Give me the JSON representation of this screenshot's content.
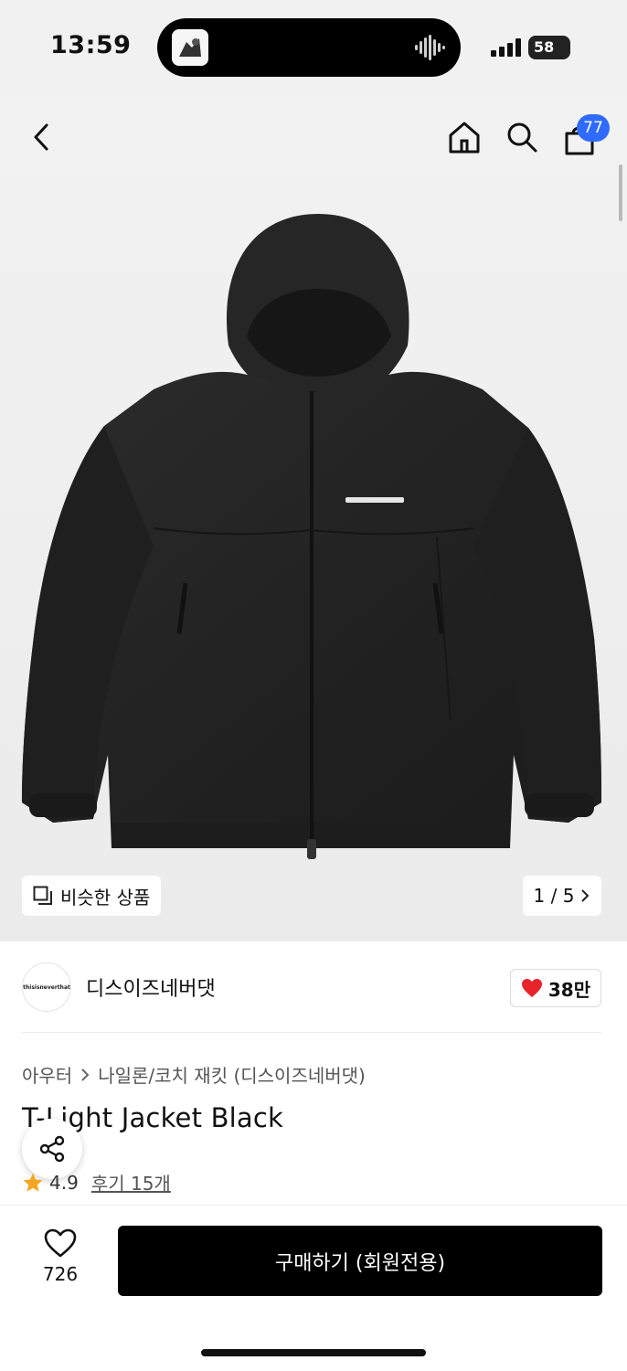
{
  "status_bar": {
    "time": "13:59",
    "battery": "58"
  },
  "header": {
    "cart_badge": "77",
    "back_icon": "chevron-left-icon",
    "home_icon": "home-icon",
    "search_icon": "search-icon",
    "cart_icon": "shopping-bag-icon"
  },
  "gallery": {
    "similar_label": "비슷한 상품",
    "pager": "1 / 5"
  },
  "brand": {
    "logo_text": "thisisneverthat",
    "name": "디스이즈네버댓",
    "likes": "38만"
  },
  "breadcrumb": {
    "category": "아우터",
    "subcategory": "나일론/코치 재킷 (디스이즈네버댓)"
  },
  "product": {
    "title": "T-Light Jacket Black",
    "rating": "4.9",
    "reviews": "후기 15개"
  },
  "bottom": {
    "wish_count": "726",
    "buy_label": "구매하기 (회원전용)"
  },
  "colors": {
    "badge": "#2f6bff",
    "heart": "#e8232a",
    "star": "#f5a623",
    "buy_button": "#000000"
  }
}
